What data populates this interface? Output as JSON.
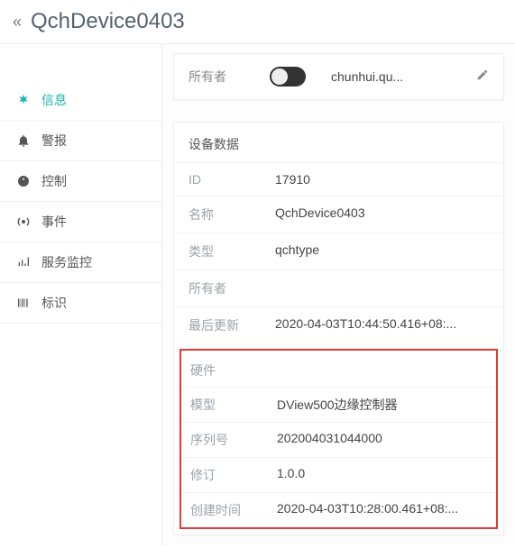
{
  "header": {
    "title": "QchDevice0403"
  },
  "sidebar": {
    "items": [
      {
        "label": "信息"
      },
      {
        "label": "警报"
      },
      {
        "label": "控制"
      },
      {
        "label": "事件"
      },
      {
        "label": "服务监控"
      },
      {
        "label": "标识"
      }
    ]
  },
  "owner_card": {
    "label": "所有者",
    "name": "chunhui.qu..."
  },
  "device_data": {
    "title": "设备数据",
    "rows": {
      "id_label": "ID",
      "id_value": "17910",
      "name_label": "名称",
      "name_value": "QchDevice0403",
      "type_label": "类型",
      "type_value": "qchtype",
      "owner_label": "所有者",
      "owner_value": "",
      "updated_label": "最后更新",
      "updated_value": "2020-04-03T10:44:50.416+08:..."
    }
  },
  "hardware": {
    "title": "硬件",
    "rows": {
      "model_label": "模型",
      "model_value": "DView500边缘控制器",
      "serial_label": "序列号",
      "serial_value": "202004031044000",
      "rev_label": "修订",
      "rev_value": "1.0.0",
      "created_label": "创建时间",
      "created_value": "2020-04-03T10:28:00.461+08:..."
    }
  }
}
